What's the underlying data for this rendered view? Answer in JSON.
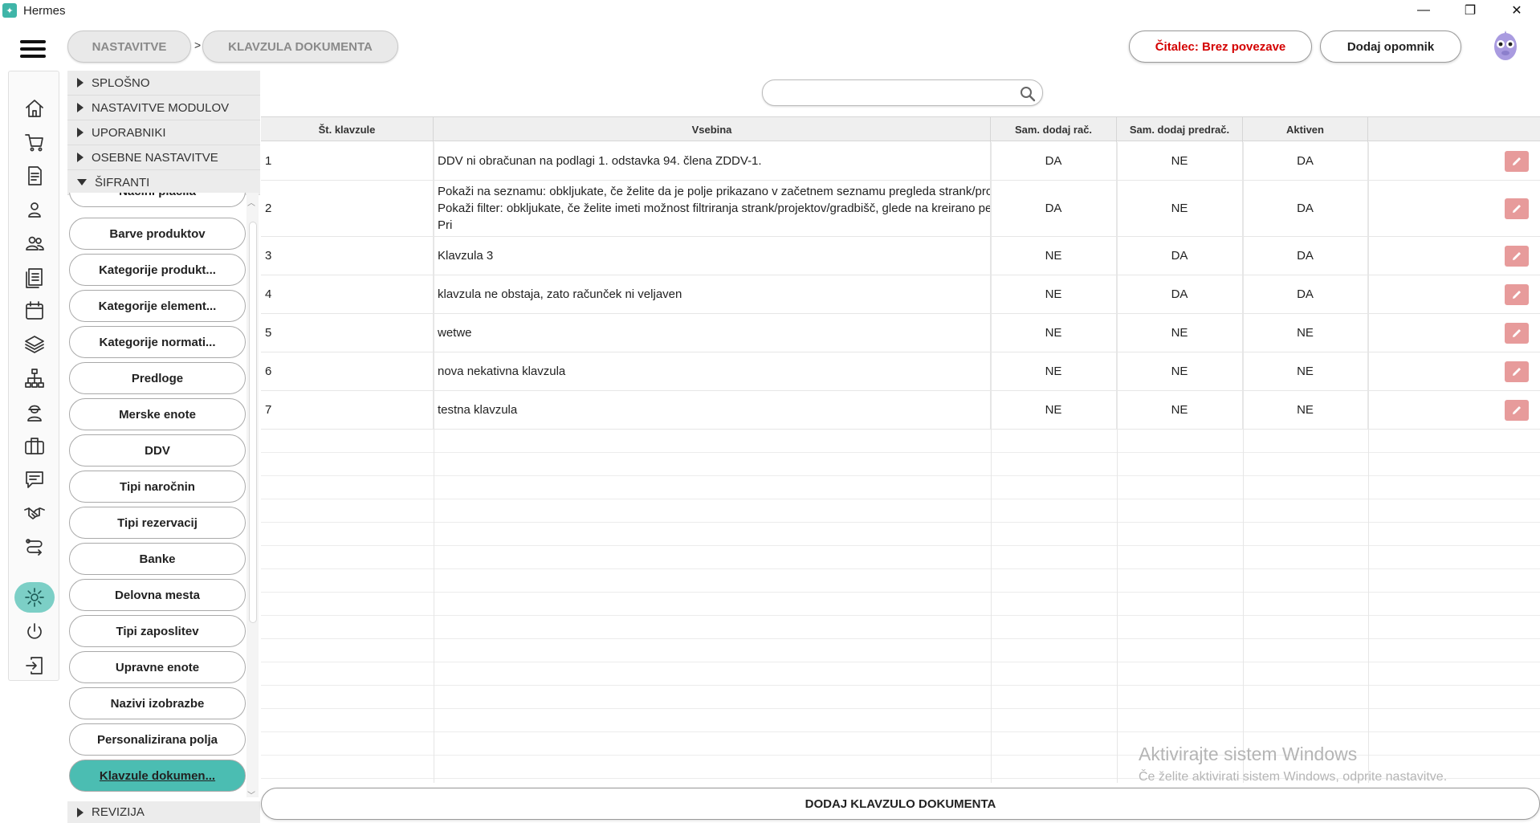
{
  "window": {
    "title": "Hermes",
    "controls": [
      "—",
      "❐",
      "✕"
    ]
  },
  "breadcrumb": {
    "items": [
      "NASTAVITVE",
      "KLAVZULA DOKUMENTA"
    ],
    "separator": ">"
  },
  "header": {
    "reader_status": "Čitalec: Brez povezave",
    "reader_status_color": "#d40000",
    "add_reminder": "Dodaj opomnik"
  },
  "sidebar_icons": [
    "home-icon",
    "cart-icon",
    "document-icon",
    "user-icon",
    "users-icon",
    "list-icon",
    "calendar-icon",
    "layers-icon",
    "hierarchy-icon",
    "worker-icon",
    "briefcase-icon",
    "chat-icon",
    "handshake-icon",
    "routes-icon",
    "settings-icon",
    "power-icon",
    "logout-icon"
  ],
  "accordion": {
    "sections": [
      "SPLOŠNO",
      "NASTAVITVE MODULOV",
      "UPORABNIKI",
      "OSEBNE NASTAVITVE",
      "ŠIFRANTI"
    ],
    "items": [
      "Načini plačila",
      "Barve produktov",
      "Kategorije produkt...",
      "Kategorije element...",
      "Kategorije normati...",
      "Predloge",
      "Merske enote",
      "DDV",
      "Tipi naročnin",
      "Tipi rezervacij",
      "Banke",
      "Delovna mesta",
      "Tipi zaposlitev",
      "Upravne enote",
      "Nazivi izobrazbe",
      "Personalizirana polja",
      "Klavzule dokumen..."
    ],
    "active_item": "Klavzule dokumen...",
    "footer": "REVIZIJA"
  },
  "search": {
    "placeholder": "",
    "value": ""
  },
  "table": {
    "columns": [
      "Št. klavzule",
      "Vsebina",
      "Sam. dodaj rač.",
      "Sam. dodaj predrač.",
      "Aktiven",
      ""
    ],
    "rows": [
      {
        "num": "1",
        "content": [
          "DDV ni obračunan na podlagi 1. odstavka 94. člena ZDDV-1."
        ],
        "invoice": "DA",
        "proforma": "NE",
        "active": "DA"
      },
      {
        "num": "2",
        "content": [
          "Pokaži na seznamu: obkljukate, če želite da je polje prikazano v začetnem seznamu pregleda strank/projektov/gradbišč",
          "Pokaži filter: obkljukate, če želite imeti možnost filtriranja strank/projektov/gradbišč, glede na kreirano personalizirano...",
          "Pri"
        ],
        "invoice": "DA",
        "proforma": "NE",
        "active": "DA"
      },
      {
        "num": "3",
        "content": [
          "Klavzula 3"
        ],
        "invoice": "NE",
        "proforma": "DA",
        "active": "DA"
      },
      {
        "num": "4",
        "content": [
          "klavzula ne obstaja, zato računček ni veljaven"
        ],
        "invoice": "NE",
        "proforma": "DA",
        "active": "DA"
      },
      {
        "num": "5",
        "content": [
          "wetwe"
        ],
        "invoice": "NE",
        "proforma": "NE",
        "active": "NE"
      },
      {
        "num": "6",
        "content": [
          "nova nekativna klavzula"
        ],
        "invoice": "NE",
        "proforma": "NE",
        "active": "NE"
      },
      {
        "num": "7",
        "content": [
          "testna klavzula"
        ],
        "invoice": "NE",
        "proforma": "NE",
        "active": "NE"
      }
    ]
  },
  "footer_button": "DODAJ KLAVZULO DOKUMENTA",
  "watermark": {
    "line1": "Aktivirajte sistem Windows",
    "line2": "Če želite aktivirati sistem Windows, odprite nastavitve."
  },
  "colors": {
    "accent": "#4bbdb2",
    "edit_button": "#e79b9b",
    "active_nav": "#7ccfc6"
  }
}
